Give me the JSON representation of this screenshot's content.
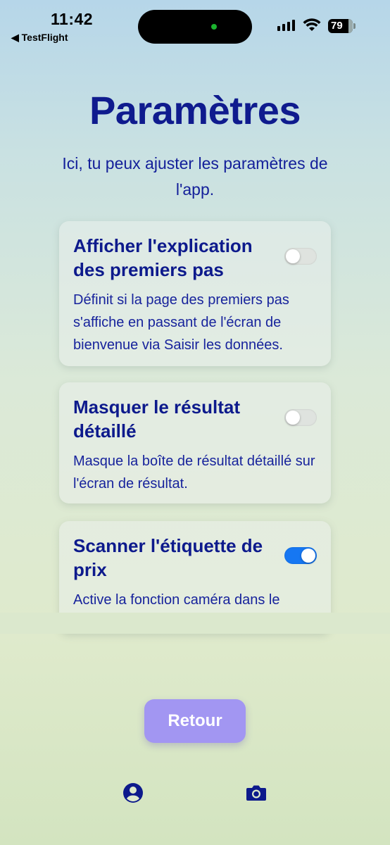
{
  "status_bar": {
    "time": "11:42",
    "back_app": "◀ TestFlight",
    "battery": "79"
  },
  "page": {
    "title": "Paramètres",
    "subtitle": "Ici, tu peux ajuster les paramètres de l'app."
  },
  "settings": [
    {
      "title": "Afficher l'explication des premiers pas",
      "description": "Définit si la page des premiers pas s'affiche en passant de l'écran de bienvenue via Saisir les données.",
      "enabled": false
    },
    {
      "title": "Masquer le résultat détaillé",
      "description": "Masque la boîte de résultat détaillé sur l'écran de résultat.",
      "enabled": false
    },
    {
      "title": "Scanner l'étiquette de prix",
      "description": "Active la fonction caméra dans le",
      "enabled": true
    }
  ],
  "actions": {
    "back_label": "Retour"
  },
  "tab_bar": {
    "items": [
      {
        "icon": "profile-icon"
      },
      {
        "icon": "camera-icon"
      }
    ]
  },
  "colors": {
    "primary_text": "#0d1a8c",
    "button_bg": "#a296f2",
    "toggle_on": "#1677f2"
  }
}
